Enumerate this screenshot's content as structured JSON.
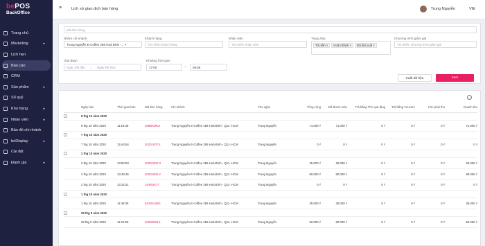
{
  "brand": {
    "line1a": "be",
    "line1b": "POS",
    "line2": "BackOffice"
  },
  "sidebar": {
    "items": [
      {
        "label": "Trang chủ",
        "arrow": ""
      },
      {
        "label": "Marketing",
        "arrow": "▸"
      },
      {
        "label": "Lịch hẹn",
        "arrow": ""
      },
      {
        "label": "Báo cáo",
        "arrow": "",
        "active": true
      },
      {
        "label": "CRM",
        "arrow": ""
      },
      {
        "label": "Sản phẩm",
        "arrow": "▸"
      },
      {
        "label": "Sổ quỹ",
        "arrow": ""
      },
      {
        "label": "Kho hàng",
        "arrow": "▸"
      },
      {
        "label": "Nhân viên",
        "arrow": "▸"
      },
      {
        "label": "Bản đồ chi nhánh",
        "arrow": ""
      },
      {
        "label": "beDisplay",
        "arrow": "▸"
      },
      {
        "label": "Cài đặt",
        "arrow": ""
      },
      {
        "label": "Đánh giá",
        "arrow": "▸"
      }
    ]
  },
  "header": {
    "title": "Lịch sử giao dịch bán hàng",
    "user": "Trung Nguyễn",
    "lang": "VIE"
  },
  "filters": {
    "order_code_placeholder": "Mã đơn hàng",
    "branch_label": "Nhóm chi nhánh",
    "branch_value": "Trung Nguyễn E-Coffee 256 Hoà Bình -...",
    "customer_label": "Khách hàng",
    "customer_placeholder": "Tìm kiếm khách hàng",
    "staff_label": "Nhân viên",
    "staff_placeholder": "Tìm kiếm nhân viên",
    "status_label": "Trạng thái",
    "status_tags": [
      "Trả dần",
      "Hoàn thành",
      "Đã đổi soát"
    ],
    "promo_label": "Chương trình giảm giá",
    "promo_placeholder": "Tìm kiếm chương trình giảm giá",
    "period_label": "Giai đoạn",
    "from_placeholder": "Ngày bắt đầu",
    "to_placeholder": "Ngày kết thúc",
    "time_label": "Khoảng thời gian",
    "time_from": "17:00",
    "time_to": "05:59",
    "export_label": "Xuất dữ liệu",
    "view_label": "Xem"
  },
  "table": {
    "columns": [
      "",
      "Ngày bán",
      "Thời gian bán",
      "Mã đơn hàng",
      "Chi nhánh",
      "Thu ngân",
      "Tổng cộng",
      "Đã thanh toán",
      "Trả bằng Thẻ quà tặng",
      "Trả bằng Voucher",
      "Còn phải thu",
      "Doanh thu"
    ],
    "rows": [
      {
        "type": "grp",
        "date": "8 thg 10 năm 2020"
      },
      {
        "type": "row",
        "date": "8 thg 10 năm 2020",
        "time": "11:16:39",
        "code": "208BKMKZ",
        "branch": "Trung Nguyên E-Coffee 256 Hoà Bình - Q11- HCM",
        "cashier": "Trung Nguyễn",
        "total": "71.000 ₫",
        "paid": "71.000 ₫",
        "gift": "0 ₫",
        "voucher": "0 ₫",
        "due": "0 ₫",
        "revenue": "71.000 ₫"
      },
      {
        "type": "grp",
        "date": "7 thg 10 năm 2020"
      },
      {
        "type": "row",
        "date": "7 thg 10 năm 2020",
        "time": "15:44:54",
        "code": "20201007-1",
        "branch": "Trung Nguyên E-Coffee 256 Hoà Bình - Q11- HCM",
        "cashier": "Trung Nguyễn",
        "total": "0 ₫",
        "paid": "0 ₫",
        "gift": "0 ₫",
        "voucher": "0 ₫",
        "due": "0 ₫",
        "revenue": "0 ₫"
      },
      {
        "type": "grp",
        "date": "2 thg 10 năm 2020"
      },
      {
        "type": "row",
        "date": "2 thg 10 năm 2020",
        "time": "13:52:53",
        "code": "20201002-3",
        "branch": "Trung Nguyên E-Coffee 256 Hoà Bình - Q11- HCM",
        "cashier": "Trung Nguyễn",
        "total": "25.000 ₫",
        "paid": "25.000 ₫",
        "gift": "0 ₫",
        "voucher": "0 ₫",
        "due": "0 ₫",
        "revenue": "25.000 ₫"
      },
      {
        "type": "row",
        "date": "2 thg 10 năm 2020",
        "time": "13:48:45",
        "code": "20201002-2",
        "branch": "Trung Nguyên E-Coffee 256 Hoà Bình - Q11- HCM",
        "cashier": "Trung Nguyễn",
        "total": "80.000 ₫",
        "paid": "80.000 ₫",
        "gift": "0 ₫",
        "voucher": "0 ₫",
        "due": "0 ₫",
        "revenue": "80.000 ₫"
      },
      {
        "type": "row",
        "date": "2 thg 10 năm 2020",
        "time": "13:24:21",
        "code": "J44RDK77",
        "branch": "Trung Nguyên E-Coffee 256 Hoà Bình - Q11- HCM",
        "cashier": "Trung Nguyễn",
        "total": "0 ₫",
        "paid": "0 ₫",
        "gift": "0 ₫",
        "voucher": "0 ₫",
        "due": "0 ₫",
        "revenue": "0 ₫"
      },
      {
        "type": "grp",
        "date": "1 thg 10 năm 2020"
      },
      {
        "type": "row",
        "date": "1 thg 10 năm 2020",
        "time": "11:46:09",
        "code": "6Z2SKUND",
        "branch": "Trung Nguyên E-Coffee 256 Hoà Bình - Q11- HCM",
        "cashier": "Trung Nguyễn",
        "total": "35.000 ₫",
        "paid": "35.000 ₫",
        "gift": "0 ₫",
        "voucher": "0 ₫",
        "due": "0 ₫",
        "revenue": "35.000 ₫"
      },
      {
        "type": "grp",
        "date": "29 thg 9 năm 2020"
      },
      {
        "type": "row",
        "date": "29 thg 9 năm 2020",
        "time": "11:21:03",
        "code": "20200929-1",
        "branch": "Trung Nguyên E-Coffee 256 Hoà Bình - Q11- HCM",
        "cashier": "Trung Nguyễn",
        "total": "60.000 ₫",
        "paid": "60.000 ₫",
        "gift": "0 ₫",
        "voucher": "0 ₫",
        "due": "0 ₫",
        "revenue": "60.000 ₫"
      }
    ]
  },
  "colors": {
    "sidebar": "#1e2140",
    "accent": "#e91e63"
  }
}
